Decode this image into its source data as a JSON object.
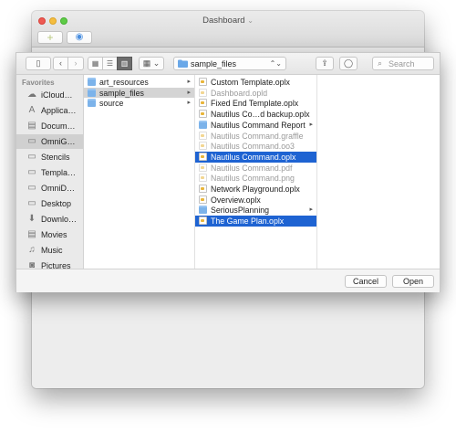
{
  "window": {
    "title": "Dashboard",
    "title_chevron": "⌄"
  },
  "bg_toolbar": {
    "add_glyph": "+",
    "eye_glyph": "◉"
  },
  "toolbar": {
    "sidebar_glyph": "▯",
    "back_glyph": "‹",
    "forward_glyph": "›",
    "view_icon_glyph": "▦",
    "view_list_glyph": "☰",
    "view_column_glyph": "▥",
    "arrange_glyph": "▦ ⌄",
    "path": "sample_files",
    "path_chevron": "⌃⌄",
    "share_glyph": "⇪",
    "tag_glyph": "◯",
    "search_placeholder": "Search",
    "search_glyph": "⌕"
  },
  "sidebar": {
    "header": "Favorites",
    "items": [
      {
        "label": "iCloud…",
        "icon": "cloud-icon",
        "glyph": "☁"
      },
      {
        "label": "Applica…",
        "icon": "applications-icon",
        "glyph": "A"
      },
      {
        "label": "Docum…",
        "icon": "documents-icon",
        "glyph": "▤"
      },
      {
        "label": "OmniG…",
        "icon": "folder-icon",
        "glyph": "▭"
      },
      {
        "label": "Stencils",
        "icon": "folder-icon",
        "glyph": "▭"
      },
      {
        "label": "Templa…",
        "icon": "folder-icon",
        "glyph": "▭"
      },
      {
        "label": "OmniD…",
        "icon": "folder-icon",
        "glyph": "▭"
      },
      {
        "label": "Desktop",
        "icon": "desktop-icon",
        "glyph": "▭"
      },
      {
        "label": "Downlo…",
        "icon": "downloads-icon",
        "glyph": "⬇"
      },
      {
        "label": "Movies",
        "icon": "movies-icon",
        "glyph": "▤"
      },
      {
        "label": "Music",
        "icon": "music-icon",
        "glyph": "♫"
      },
      {
        "label": "Pictures",
        "icon": "pictures-icon",
        "glyph": "◙"
      }
    ]
  },
  "column1": {
    "items": [
      {
        "label": "art_resources",
        "arrow": "▸"
      },
      {
        "label": "sample_files",
        "arrow": "▸"
      },
      {
        "label": "source",
        "arrow": "▸"
      }
    ]
  },
  "column2": {
    "items": [
      {
        "label": "Custom Template.oplx"
      },
      {
        "label": "Dashboard.opld"
      },
      {
        "label": "Fixed End Template.oplx"
      },
      {
        "label": "Nautilus Co…d backup.oplx"
      },
      {
        "label": "Nautilus Command Report",
        "arrow": "▸"
      },
      {
        "label": "Nautilus Command.graffle"
      },
      {
        "label": "Nautilus Command.oo3"
      },
      {
        "label": "Nautilus Command.oplx"
      },
      {
        "label": "Nautilus Command.pdf"
      },
      {
        "label": "Nautilus Command.png"
      },
      {
        "label": "Network Playground.oplx"
      },
      {
        "label": "Overview.oplx"
      },
      {
        "label": "SeriousPlanning",
        "arrow": "▸"
      },
      {
        "label": "The Game Plan.oplx"
      }
    ]
  },
  "footer": {
    "cancel_label": "Cancel",
    "open_label": "Open"
  }
}
